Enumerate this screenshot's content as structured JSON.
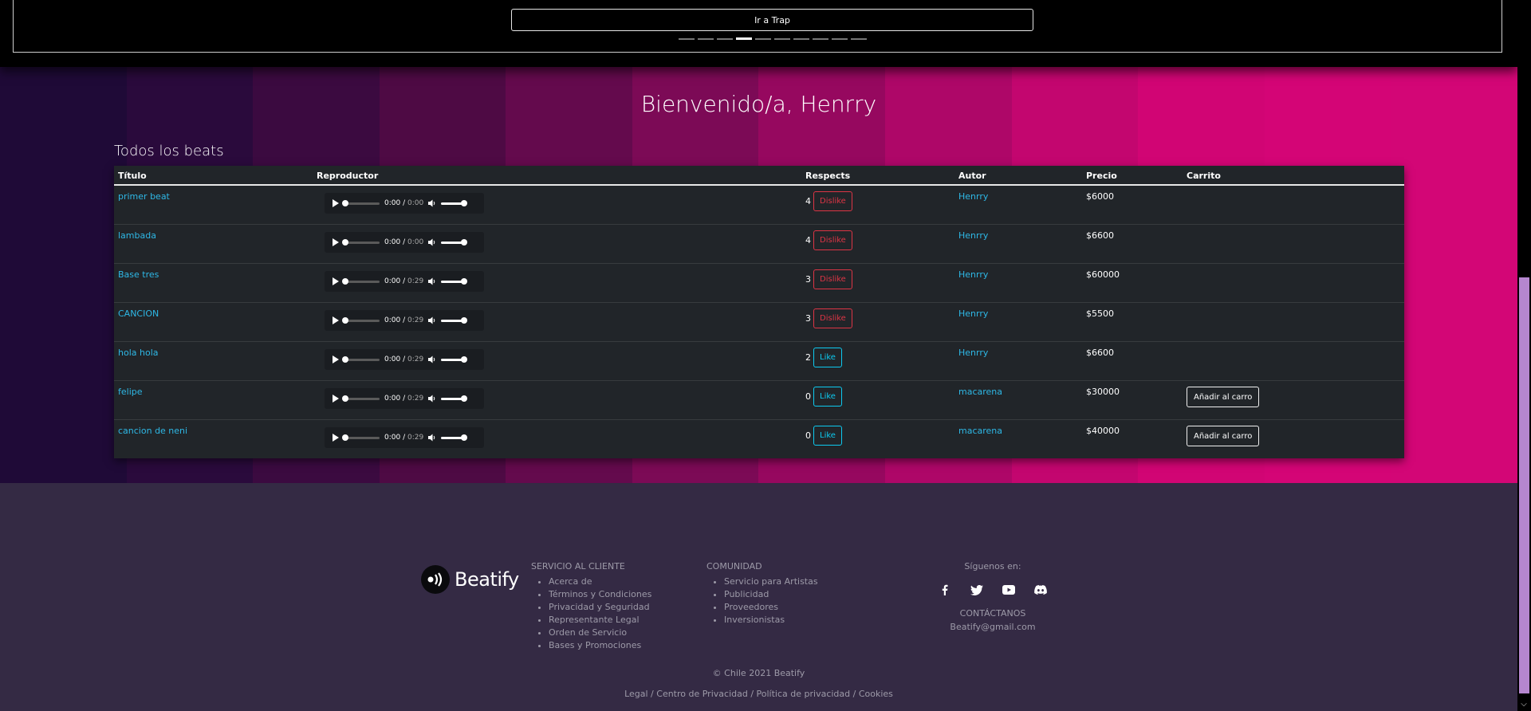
{
  "carousel": {
    "button_label": "Ir a Trap",
    "indicator_count": 10,
    "active_index": 3
  },
  "hero": {
    "welcome": "Bienvenido/a, Henrry",
    "section_title": "Todos los beats",
    "tile_colors": [
      "#1f0a37",
      "#2a0a3c",
      "#3b0a40",
      "#4e0a44",
      "#640a4d",
      "#7c0a56",
      "#96085f",
      "#ae0768",
      "#c3066f",
      "#d10574",
      "#d40576",
      "#d30676"
    ]
  },
  "table": {
    "headers": {
      "title": "Título",
      "player": "Reproductor",
      "respects": "Respects",
      "author": "Autor",
      "price": "Precio",
      "cart": "Carrito"
    },
    "rows": [
      {
        "title": "primer beat",
        "current": "0:00",
        "duration": "0:00",
        "respects": "4",
        "action": "Dislike",
        "author": "Henrry",
        "price": "$6000",
        "cart": ""
      },
      {
        "title": "lambada",
        "current": "0:00",
        "duration": "0:00",
        "respects": "4",
        "action": "Dislike",
        "author": "Henrry",
        "price": "$6600",
        "cart": ""
      },
      {
        "title": "Base tres",
        "current": "0:00",
        "duration": "0:29",
        "respects": "3",
        "action": "Dislike",
        "author": "Henrry",
        "price": "$60000",
        "cart": ""
      },
      {
        "title": "CANCION",
        "current": "0:00",
        "duration": "0:29",
        "respects": "3",
        "action": "Dislike",
        "author": "Henrry",
        "price": "$5500",
        "cart": ""
      },
      {
        "title": "hola hola",
        "current": "0:00",
        "duration": "0:29",
        "respects": "2",
        "action": "Like",
        "author": "Henrry",
        "price": "$6600",
        "cart": ""
      },
      {
        "title": "felipe",
        "current": "0:00",
        "duration": "0:29",
        "respects": "0",
        "action": "Like",
        "author": "macarena",
        "price": "$30000",
        "cart": "Añadir al carro"
      },
      {
        "title": "cancion de neni",
        "current": "0:00",
        "duration": "0:29",
        "respects": "0",
        "action": "Like",
        "author": "macarena",
        "price": "$40000",
        "cart": "Añadir al carro"
      }
    ]
  },
  "footer": {
    "brand": "Beatify",
    "service": {
      "heading": "SERVICIO AL CLIENTE",
      "items": [
        "Acerca de",
        "Términos y Condiciones",
        "Privacidad y Seguridad",
        "Representante Legal",
        "Orden de Servicio",
        "Bases y Promociones"
      ]
    },
    "community": {
      "heading": "COMUNIDAD",
      "items": [
        "Servicio para Artistas",
        "Publicidad",
        "Proveedores",
        "Inversionistas"
      ]
    },
    "follow": "Síguenos en:",
    "social_icons": [
      "facebook-icon",
      "twitter-icon",
      "youtube-icon",
      "discord-icon"
    ],
    "contact_heading": "CONTÁCTANOS",
    "email": "Beatify@gmail.com",
    "copyright": "© Chile 2021 Beatify",
    "legal": "Legal / Centro de Privacidad / Política de privacidad / Cookies"
  }
}
